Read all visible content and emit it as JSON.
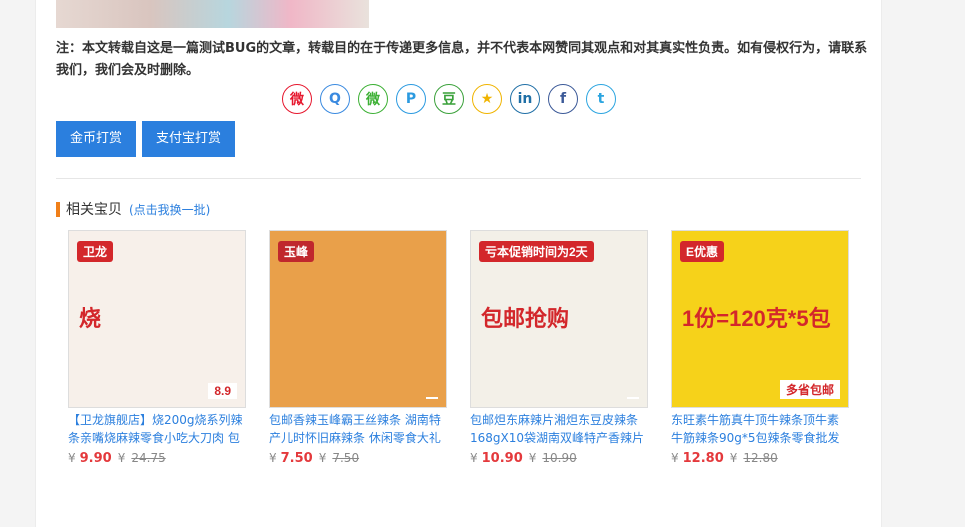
{
  "article": {
    "notice": "注：本文转载自这是一篇测试BUG的文章，转载目的在于传递更多信息，并不代表本网赞同其观点和对其真实性负责。如有侵权行为，请联系我们，我们会及时删除。"
  },
  "share": {
    "buttons": [
      {
        "name": "weibo-icon",
        "glyph": "微",
        "color": "#e6162d"
      },
      {
        "name": "qq-icon",
        "glyph": "Q",
        "color": "#3a8ae0"
      },
      {
        "name": "wechat-icon",
        "glyph": "微",
        "color": "#3cb034"
      },
      {
        "name": "pinterest-icon",
        "glyph": "P",
        "color": "#2b9ae0"
      },
      {
        "name": "douban-icon",
        "glyph": "豆",
        "color": "#3aa13a"
      },
      {
        "name": "favorite-icon",
        "glyph": "★",
        "color": "#f0b400"
      },
      {
        "name": "linkedin-icon",
        "glyph": "in",
        "color": "#1f6fa6"
      },
      {
        "name": "facebook-icon",
        "glyph": "f",
        "color": "#3b5998"
      },
      {
        "name": "twitter-icon",
        "glyph": "t",
        "color": "#2ca5e0"
      }
    ]
  },
  "reward": {
    "coin_label": "金币打赏",
    "alipay_label": "支付宝打赏"
  },
  "related": {
    "title": "相关宝贝",
    "refresh_link": "(点击我换一批)",
    "currency": "¥",
    "items": [
      {
        "title": "【卫龙旗舰店】烧200g烧系列辣条亲嘴烧麻辣零食小吃大刀肉 包",
        "price": "9.90",
        "old_price": "24.75",
        "thumb": {
          "bg": "#f7f0ea",
          "label": "卫龙",
          "accent": "#d3272b",
          "caption": "烧",
          "promo": "8.9"
        }
      },
      {
        "title": "包邮香辣玉峰霸王丝辣条 湖南特产儿时怀旧麻辣条 休闲零食大礼",
        "price": "7.50",
        "old_price": "7.50",
        "thumb": {
          "bg": "#e9a04a",
          "label": "玉峰",
          "accent": "#c0272d",
          "caption": "",
          "promo": ""
        }
      },
      {
        "title": "包邮炟东麻辣片湘炟东豆皮辣条168gX10袋湖南双峰特产香辣片",
        "price": "10.90",
        "old_price": "10.90",
        "thumb": {
          "bg": "#f3f0e8",
          "label": "亏本促销时间为2天",
          "accent": "#d3272b",
          "caption": "包邮抢购",
          "promo": ""
        }
      },
      {
        "title": "东旺素牛筋真牛顶牛辣条顶牛素牛筋辣条90g*5包辣条零食批发",
        "price": "12.80",
        "old_price": "12.80",
        "thumb": {
          "bg": "#f6d21a",
          "label": "E优惠",
          "accent": "#d3272b",
          "caption": "1份=120克*5包",
          "promo": "多省包邮"
        }
      }
    ]
  }
}
